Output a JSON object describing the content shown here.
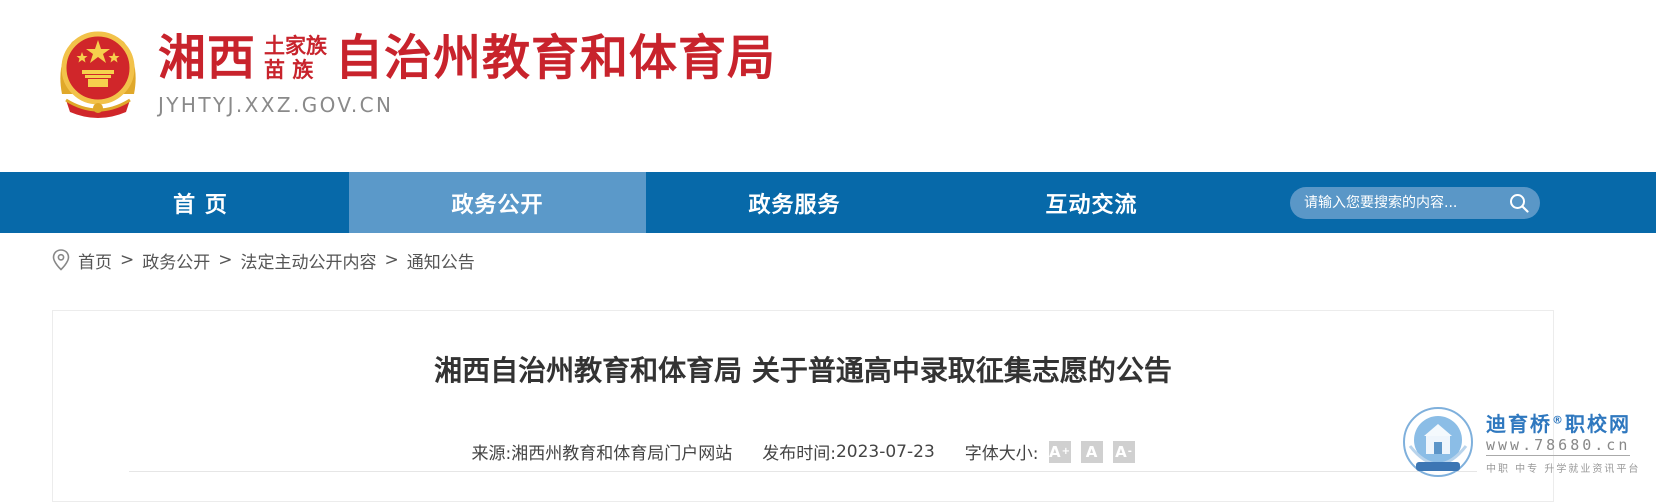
{
  "header": {
    "title_part1": "湘西",
    "title_stack_top": "土家族",
    "title_stack_bottom": "苗 族",
    "title_part2": "自治州教育和体育局",
    "domain": "JYHTYJ.XXZ.GOV.CN",
    "emblem_icon": "national-emblem-icon"
  },
  "nav": {
    "items": [
      {
        "label": "首 页"
      },
      {
        "label": "政务公开",
        "active": true
      },
      {
        "label": "政务服务"
      },
      {
        "label": "互动交流"
      }
    ],
    "search_placeholder": "请输入您要搜索的内容...",
    "search_icon": "search-icon"
  },
  "breadcrumb": {
    "icon": "location-pin-icon",
    "separator": ">",
    "items": [
      "首页",
      "政务公开",
      "法定主动公开内容",
      "通知公告"
    ]
  },
  "article": {
    "title": "湘西自治州教育和体育局 关于普通高中录取征集志愿的公告",
    "source_label": "来源:",
    "source_value": "湘西州教育和体育局门户网站",
    "date_label": "发布时间:",
    "date_value": "2023-07-23",
    "font_size_label": "字体大小:",
    "font_buttons": [
      "A",
      "A",
      "A"
    ],
    "font_button_marks": [
      "+",
      "",
      "-"
    ]
  },
  "watermark": {
    "name": "迪育桥",
    "registered": "®",
    "name_suffix": "职校网",
    "url": "www.78680.cn",
    "tagline": "中职 中专 升学就业资讯平台"
  },
  "colors": {
    "brand_red": "#c8232c",
    "nav_blue": "#0769a9",
    "nav_active": "#5b99c9",
    "watermark_blue": "#2f78bf"
  }
}
